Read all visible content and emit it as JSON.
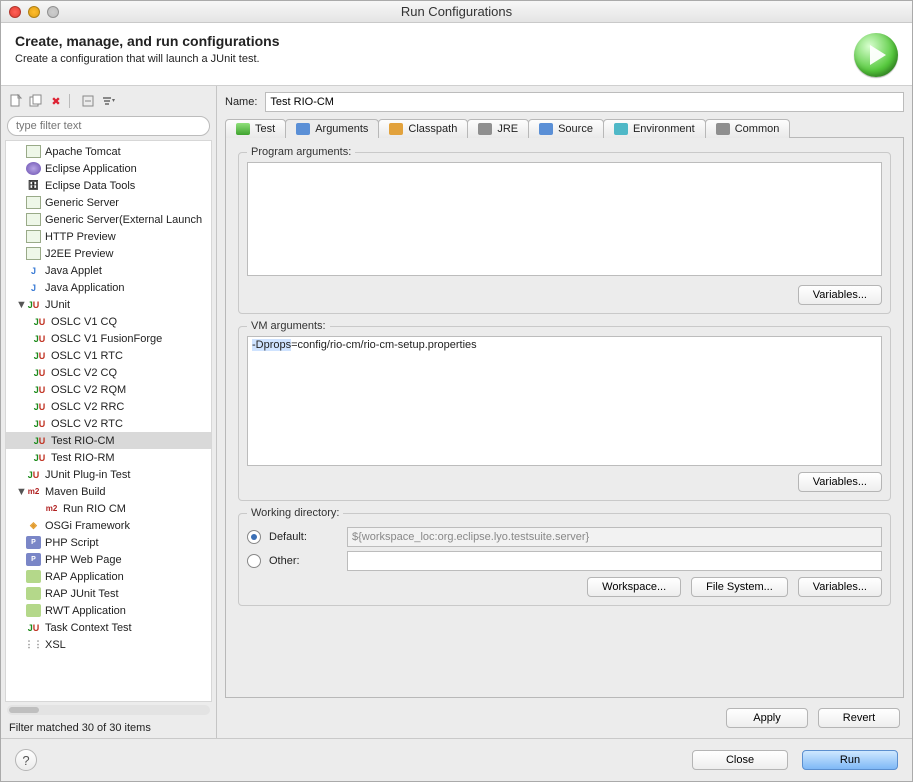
{
  "window": {
    "title": "Run Configurations"
  },
  "header": {
    "title": "Create, manage, and run configurations",
    "subtitle": "Create a configuration that will launch a JUnit test."
  },
  "filter": {
    "placeholder": "type filter text"
  },
  "filter_status": "Filter matched 30 of 30 items",
  "tree": [
    {
      "label": "Apache Tomcat",
      "lvl": 1,
      "icon": "server"
    },
    {
      "label": "Eclipse Application",
      "lvl": 1,
      "icon": "eclipse"
    },
    {
      "label": "Eclipse Data Tools",
      "lvl": 1,
      "icon": "db"
    },
    {
      "label": "Generic Server",
      "lvl": 1,
      "icon": "server"
    },
    {
      "label": "Generic Server(External Launch",
      "lvl": 1,
      "icon": "server"
    },
    {
      "label": "HTTP Preview",
      "lvl": 1,
      "icon": "server"
    },
    {
      "label": "J2EE Preview",
      "lvl": 1,
      "icon": "server"
    },
    {
      "label": "Java Applet",
      "lvl": 1,
      "icon": "applet"
    },
    {
      "label": "Java Application",
      "lvl": 1,
      "icon": "java"
    },
    {
      "label": "JUnit",
      "lvl": 1,
      "icon": "junit",
      "expanded": true
    },
    {
      "label": "OSLC V1 CQ",
      "lvl": 2,
      "icon": "junit"
    },
    {
      "label": "OSLC V1 FusionForge",
      "lvl": 2,
      "icon": "junit"
    },
    {
      "label": "OSLC V1 RTC",
      "lvl": 2,
      "icon": "junit"
    },
    {
      "label": "OSLC V2 CQ",
      "lvl": 2,
      "icon": "junit"
    },
    {
      "label": "OSLC V2 RQM",
      "lvl": 2,
      "icon": "junit"
    },
    {
      "label": "OSLC V2 RRC",
      "lvl": 2,
      "icon": "junit"
    },
    {
      "label": "OSLC V2 RTC",
      "lvl": 2,
      "icon": "junit"
    },
    {
      "label": "Test RIO-CM",
      "lvl": 2,
      "icon": "junit",
      "selected": true
    },
    {
      "label": "Test RIO-RM",
      "lvl": 2,
      "icon": "junit"
    },
    {
      "label": "JUnit Plug-in Test",
      "lvl": 1,
      "icon": "junit-plugin"
    },
    {
      "label": "Maven Build",
      "lvl": 1,
      "icon": "m2",
      "expanded": true
    },
    {
      "label": "Run RIO CM",
      "lvl": "2b",
      "icon": "m2"
    },
    {
      "label": "OSGi Framework",
      "lvl": 1,
      "icon": "osgi"
    },
    {
      "label": "PHP Script",
      "lvl": 1,
      "icon": "php"
    },
    {
      "label": "PHP Web Page",
      "lvl": 1,
      "icon": "php"
    },
    {
      "label": "RAP Application",
      "lvl": 1,
      "icon": "rap"
    },
    {
      "label": "RAP JUnit Test",
      "lvl": 1,
      "icon": "rap"
    },
    {
      "label": "RWT Application",
      "lvl": 1,
      "icon": "rap"
    },
    {
      "label": "Task Context Test",
      "lvl": 1,
      "icon": "junit"
    },
    {
      "label": "XSL",
      "lvl": 1,
      "icon": "xsl"
    }
  ],
  "name": {
    "label": "Name:",
    "value": "Test RIO-CM"
  },
  "tabs": [
    "Test",
    "Arguments",
    "Classpath",
    "JRE",
    "Source",
    "Environment",
    "Common"
  ],
  "active_tab": 1,
  "program_args": {
    "legend": "Program arguments:",
    "value": "",
    "variables": "Variables..."
  },
  "vm_args": {
    "legend": "VM arguments:",
    "prefix": "-Dprops",
    "suffix": "=config/rio-cm/rio-cm-setup.properties",
    "variables": "Variables..."
  },
  "working_dir": {
    "legend": "Working directory:",
    "default_label": "Default:",
    "other_label": "Other:",
    "default_value": "${workspace_loc:org.eclipse.lyo.testsuite.server}",
    "workspace": "Workspace...",
    "filesystem": "File System...",
    "variables": "Variables..."
  },
  "actions": {
    "apply": "Apply",
    "revert": "Revert"
  },
  "footer": {
    "close": "Close",
    "run": "Run"
  }
}
